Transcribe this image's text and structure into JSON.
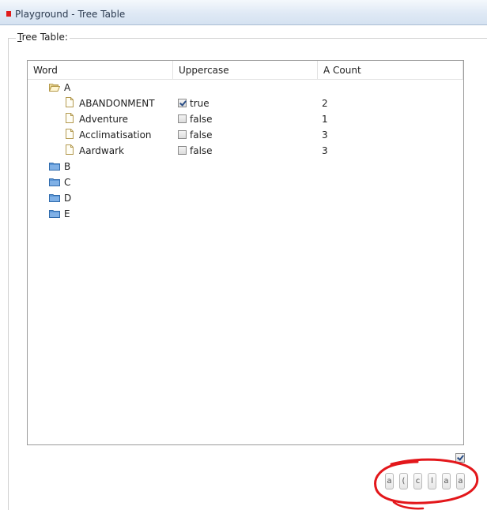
{
  "window": {
    "title": "Playground - Tree Table"
  },
  "group": {
    "label_mnemonic": "T",
    "label_rest": "ree Table:"
  },
  "table": {
    "columns": [
      "Word",
      "Uppercase",
      "A Count"
    ],
    "folders": [
      {
        "label": "A",
        "expanded": true,
        "icon": "open-folder-icon"
      },
      {
        "label": "B",
        "expanded": false,
        "icon": "folder-icon"
      },
      {
        "label": "C",
        "expanded": false,
        "icon": "folder-icon"
      },
      {
        "label": "D",
        "expanded": false,
        "icon": "folder-icon"
      },
      {
        "label": "E",
        "expanded": false,
        "icon": "folder-icon"
      }
    ],
    "rows": [
      {
        "word": "ABANDONMENT",
        "uppercase": "true",
        "checked": true,
        "count": "2"
      },
      {
        "word": "Adventure",
        "uppercase": "false",
        "checked": false,
        "count": "1"
      },
      {
        "word": "Acclimatisation",
        "uppercase": "false",
        "checked": false,
        "count": "3"
      },
      {
        "word": "Aardwark",
        "uppercase": "false",
        "checked": false,
        "count": "3"
      }
    ]
  },
  "bottom": {
    "checkbox_checked": true,
    "buttons": [
      "a",
      "(",
      "c",
      "l",
      "a",
      "a"
    ]
  },
  "colors": {
    "annotation": "#e3171b",
    "title_icon": "#e01a1a",
    "folder_blue": "#3d7fc9",
    "check_mark": "#2a4e86"
  }
}
